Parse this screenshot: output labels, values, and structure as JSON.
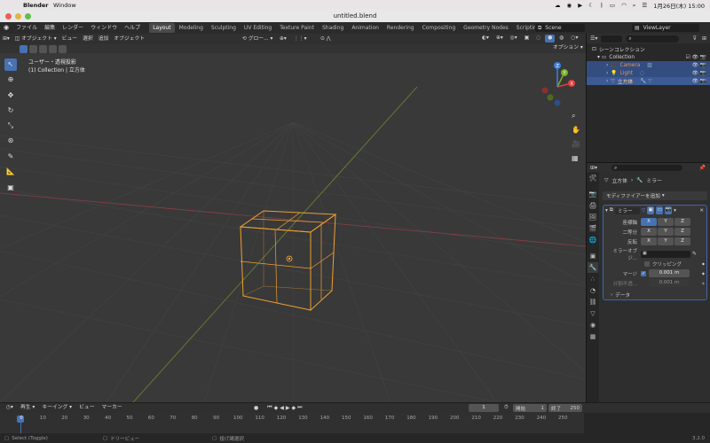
{
  "macbar": {
    "app": "Blender",
    "menu": [
      "Window"
    ],
    "datetime": "1月26日(木)  15:00"
  },
  "window": {
    "title": "untitled.blend"
  },
  "topbar": {
    "menus": [
      "ファイル",
      "編集",
      "レンダー",
      "ウィンドウ",
      "ヘルプ"
    ],
    "workspaces": [
      "Layout",
      "Modeling",
      "Sculpting",
      "UV Editing",
      "Texture Paint",
      "Shading",
      "Animation",
      "Rendering",
      "Compositing",
      "Geometry Nodes",
      "Scripting"
    ],
    "active_workspace": "Layout",
    "scene": "Scene",
    "viewlayer": "ViewLayer"
  },
  "viewport_header": {
    "mode": "オブジェクト",
    "menus": [
      "ビュー",
      "選択",
      "追加",
      "オブジェクト"
    ],
    "transform": "グロー...",
    "options": "オプション"
  },
  "viewport": {
    "view_name": "ユーザー・透視投影",
    "collection_info": "(1) Collection | 立方体"
  },
  "outliner": {
    "root": "シーンコレクション",
    "collection": "Collection",
    "items": [
      {
        "name": "Camera",
        "color": "#e8944a"
      },
      {
        "name": "Light",
        "color": "#e8944a"
      },
      {
        "name": "立方体",
        "color": "#e0b070"
      }
    ]
  },
  "properties": {
    "breadcrumb_object": "立方体",
    "breadcrumb_mod": "ミラー",
    "add_modifier": "モディファイアーを追加",
    "modifier_name": "ミラー",
    "rows": [
      {
        "label": "座標軸",
        "x": "X",
        "y": "Y",
        "z": "Z"
      },
      {
        "label": "二等分",
        "x": "X",
        "y": "Y",
        "z": "Z"
      },
      {
        "label": "反転",
        "x": "X",
        "y": "Y",
        "z": "Z"
      }
    ],
    "mirror_object_label": "ミラーオブジ...",
    "clipping_label": "クリッピング",
    "merge_label": "マージ",
    "merge_value": "0.001 m",
    "bisect_label": "分割不透...",
    "bisect_value": "0.001 m",
    "data_label": "データ"
  },
  "timeline": {
    "menus": [
      "再生",
      "キーイング",
      "ビュー",
      "マーカー"
    ],
    "current_frame": "1",
    "start_label": "開始",
    "start": "1",
    "end_label": "終了",
    "end": "250",
    "ticks": [
      "0",
      "10",
      "20",
      "30",
      "40",
      "50",
      "60",
      "70",
      "80",
      "90",
      "100",
      "110",
      "120",
      "130",
      "140",
      "150",
      "160",
      "170",
      "180",
      "190",
      "200",
      "210",
      "220",
      "230",
      "240",
      "250"
    ]
  },
  "status": {
    "left": "Select (Toggle)",
    "mid": "ドリービュー",
    "right_hint": "投げ縄選択",
    "version": "3.2.0"
  }
}
